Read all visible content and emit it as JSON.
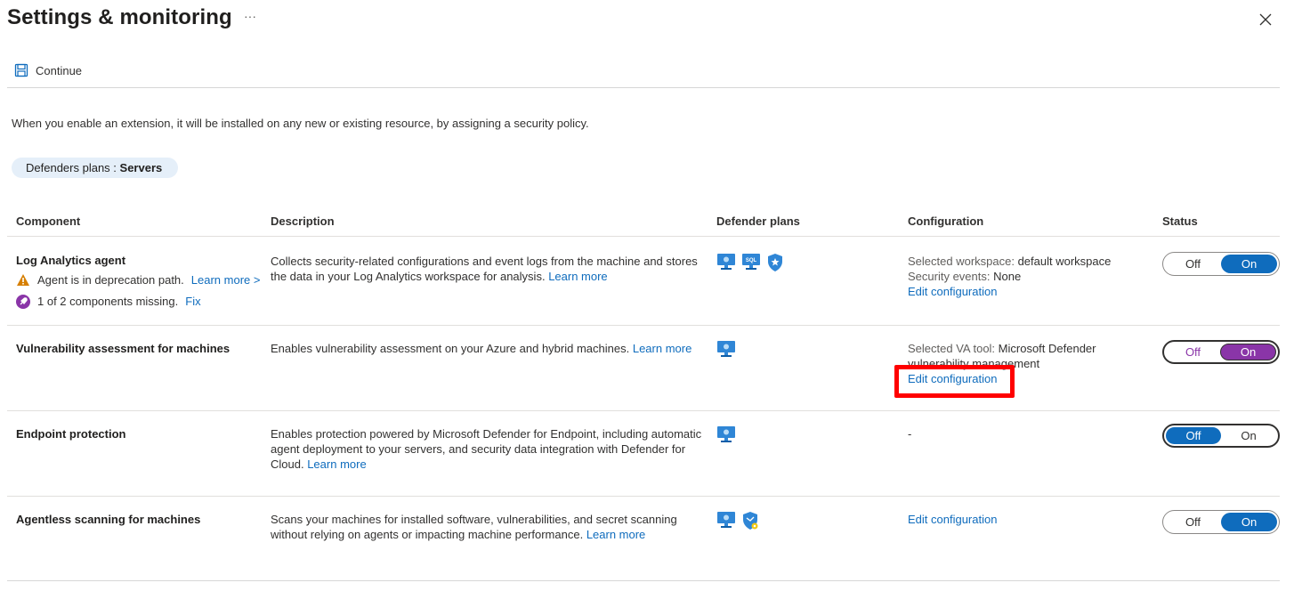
{
  "header": {
    "title": "Settings & monitoring",
    "more": "···"
  },
  "toolbar": {
    "continue_label": "Continue"
  },
  "intro": "When you enable an extension, it will be installed on any new or existing resource, by assigning a security policy.",
  "pill": {
    "label": "Defenders plans :",
    "value": "Servers"
  },
  "table": {
    "headers": [
      "Component",
      "Description",
      "Defender plans",
      "Configuration",
      "Status"
    ],
    "rows": [
      {
        "name": "Log Analytics agent",
        "warning": "Agent is in deprecation path.",
        "warning_link": "Learn more >",
        "missing": "1 of 2 components missing.",
        "missing_link": "Fix",
        "description": "Collects security-related configurations and event logs from the machine and stores the data in your Log Analytics workspace for analysis.",
        "description_link": "Learn more",
        "config_line1_label": "Selected workspace:",
        "config_line1_value": "default workspace",
        "config_line2_label": "Security events:",
        "config_line2_value": "None",
        "config_link": "Edit configuration",
        "off": "Off",
        "on": "On",
        "state": "On"
      },
      {
        "name": "Vulnerability assessment for machines",
        "description": "Enables vulnerability assessment on your Azure and hybrid machines.",
        "description_link": "Learn more",
        "config_line1_label": "Selected VA tool:",
        "config_line1_value": "Microsoft Defender vulnerability management",
        "config_link": "Edit configuration",
        "off": "Off",
        "on": "On",
        "state": "On"
      },
      {
        "name": "Endpoint protection",
        "description": "Enables protection powered by Microsoft Defender for Endpoint, including automatic agent deployment to your servers, and security data integration with Defender for Cloud.",
        "description_link": "Learn more",
        "config_dash": "-",
        "off": "Off",
        "on": "On",
        "state": "Off"
      },
      {
        "name": "Agentless scanning for machines",
        "description": "Scans your machines for installed software, vulnerabilities, and secret scanning without relying on agents or impacting machine performance.",
        "description_link": "Learn more",
        "config_link": "Edit configuration",
        "off": "Off",
        "on": "On",
        "state": "On"
      }
    ]
  },
  "colors": {
    "link": "#0f6cbd",
    "toggle_on": "#0f6cbd",
    "toggle_focus_on": "#8a35a8",
    "highlight": "#ff0000",
    "warning": "#d67f00",
    "rocket": "#8a35a8"
  },
  "icons": [
    "save-icon",
    "close-icon",
    "warning-icon",
    "rocket-icon",
    "server-icon",
    "sql-icon",
    "shield-star-icon",
    "shield-gear-icon"
  ]
}
